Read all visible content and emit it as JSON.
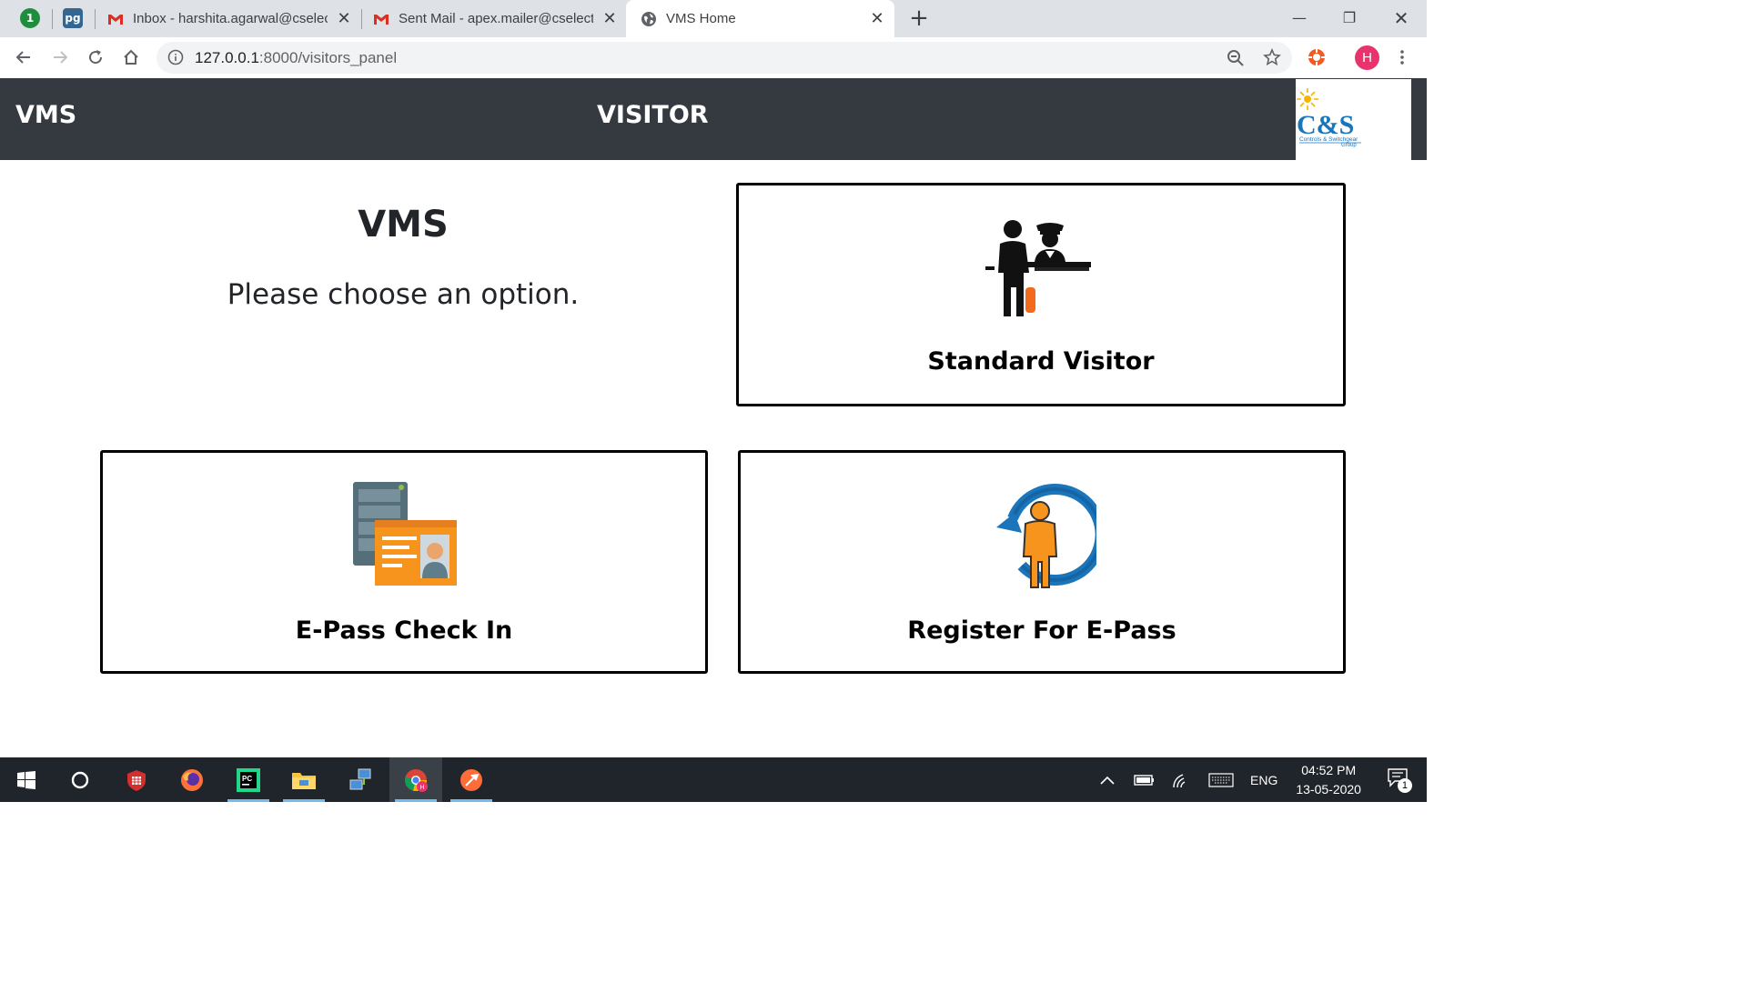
{
  "browser": {
    "tabs": [
      {
        "label": "Inbox - harshita.agarwal@cselect",
        "icon": "gmail-icon"
      },
      {
        "label": "Sent Mail - apex.mailer@cselectri",
        "icon": "gmail-icon"
      },
      {
        "label": "VMS Home",
        "icon": "globe-icon",
        "active": true
      }
    ],
    "pinned_tabs": [
      {
        "icon": "extension-badge-icon",
        "text": "1"
      },
      {
        "icon": "pgadmin-icon",
        "text": "pg"
      }
    ],
    "url_host": "127.0.0.1",
    "url_rest": ":8000/visitors_panel",
    "profile_initial": "H"
  },
  "navbar": {
    "brand": "VMS",
    "title": "VISITOR",
    "logo": {
      "main": "C&S",
      "sub": "Controls & Switchgear",
      "tag": "Group"
    }
  },
  "intro": {
    "title": "VMS",
    "subtitle": "Please choose an option."
  },
  "options": {
    "standard_visitor": "Standard Visitor",
    "epass_checkin": "E-Pass Check In",
    "register_epass": "Register For E-Pass"
  },
  "taskbar": {
    "language": "ENG",
    "time": "04:52 PM",
    "date": "13-05-2020",
    "notification_count": "1"
  },
  "colors": {
    "navbar": "#343a40",
    "orange": "#f7941d",
    "blue": "#1b75bb"
  }
}
